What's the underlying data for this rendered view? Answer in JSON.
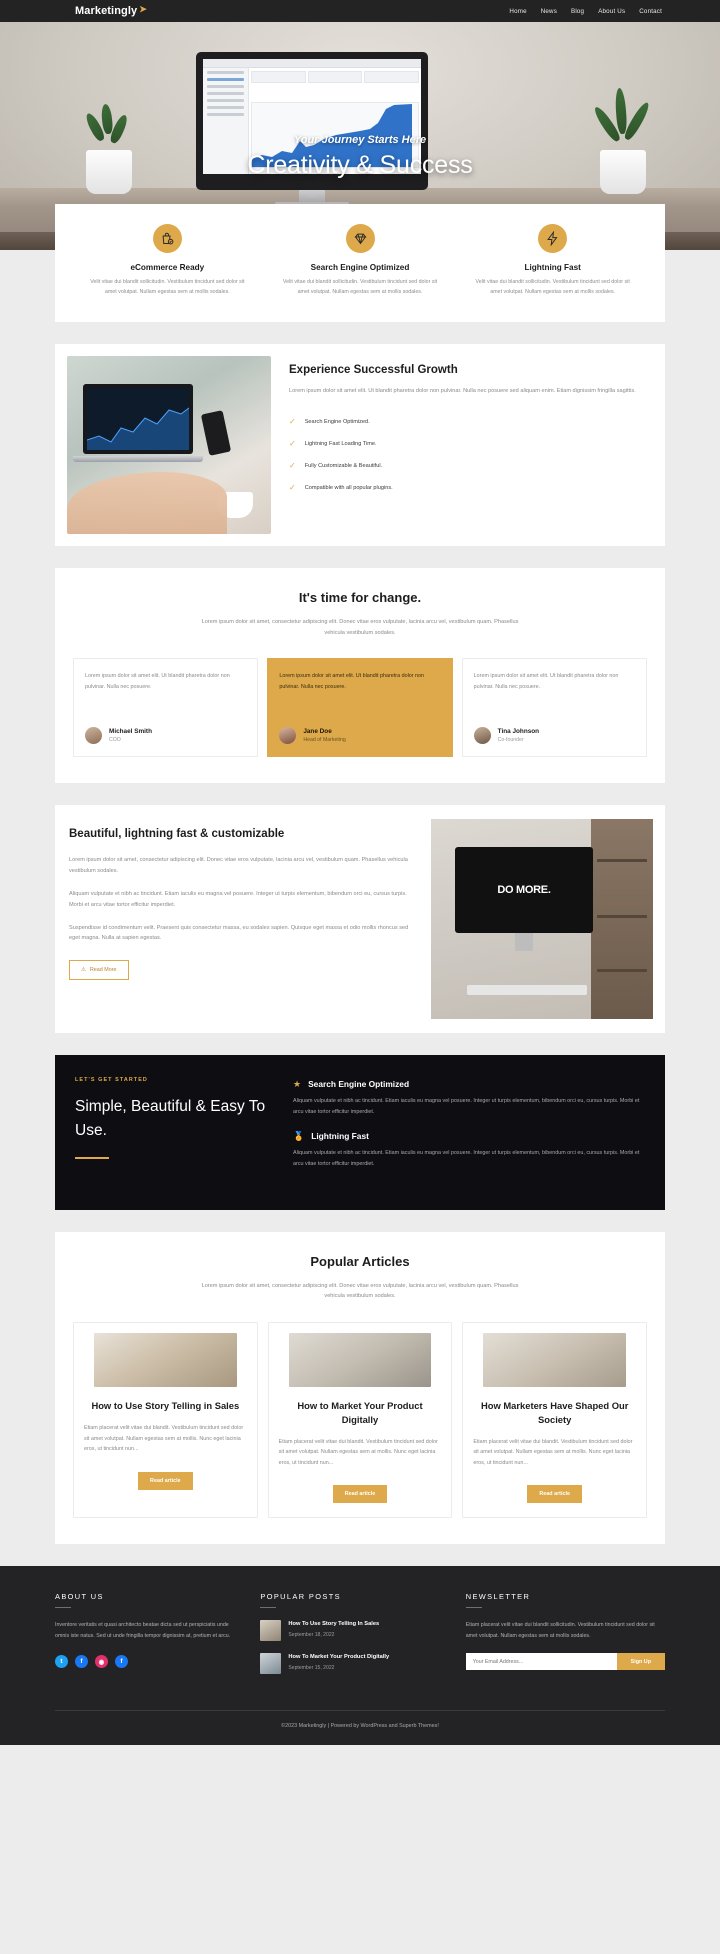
{
  "header": {
    "brand": "Marketingly",
    "brand_icon": "paper-plane-icon",
    "nav": [
      {
        "label": "Home"
      },
      {
        "label": "News"
      },
      {
        "label": "Blog"
      },
      {
        "label": "About Us"
      },
      {
        "label": "Contact"
      }
    ]
  },
  "hero": {
    "subtitle": "Your Journey Starts Here",
    "title": "Creativity & Success"
  },
  "features": [
    {
      "icon": "shopping-bag-check-icon",
      "title": "eCommerce Ready",
      "desc": "Velit vitae dui blandit sollicitudin. Vestibulum tincidunt sed dolor sit amet volutpat. Nullam egestas sem at mollis sodales."
    },
    {
      "icon": "diamond-icon",
      "title": "Search Engine Optimized",
      "desc": "Velit vitae dui blandit sollicitudin. Vestibulum tincidunt sed dolor sit amet volutpat. Nullam egestas sem at mollis sodales."
    },
    {
      "icon": "lightning-bolt-icon",
      "title": "Lightning Fast",
      "desc": "Velit vitae dui blandit sollicitudin. Vestibulum tincidunt sed dolor sit amet volutpat. Nullam egestas sem at mollis sodales."
    }
  ],
  "growth": {
    "title": "Experience Successful Growth",
    "paragraph": "Lorem ipsum dolor sit amet elit. Ut blandit pharetra dolor non pulvinar. Nulla nec posuere sed aliquam enim. Etiam dignissim fringilla sagittis.",
    "checks": [
      "Search Engine Optimized.",
      "Lightning Fast Loading Time.",
      "Fully Customizable & Beautiful.",
      "Compatible with all popular plugins."
    ]
  },
  "testimonials": {
    "title": "It's time for change.",
    "intro": "Lorem ipsum dolor sit amet, consectetur adipiscing elit. Donec vitae eros vulputate, lacinia arcu vel, vestibulum quam. Phasellus vehicula vestibulum sodales.",
    "cards": [
      {
        "quote": "Lorem ipsum dolor sit amet elit. Ut blandit pharetra dolor non pulvinar. Nulla nec posuere.",
        "name": "Michael Smith",
        "role": "COO"
      },
      {
        "quote": "Lorem ipsum dolor sit amet elit. Ut blandit pharetra dolor non pulvinar. Nulla nec posuere.",
        "name": "Jane Doe",
        "role": "Head of Marketing"
      },
      {
        "quote": "Lorem ipsum dolor sit amet elit. Ut blandit pharetra dolor non pulvinar. Nulla nec posuere.",
        "name": "Tina Johnson",
        "role": "Co-founder"
      }
    ]
  },
  "beauty": {
    "title": "Beautiful, lightning fast & customizable",
    "p1": "Lorem ipsum dolor sit amet, consectetur adipiscing elit. Donec vitae eros vulputate, lacinia arcu vel, vestibulum quam. Phasellus vehicula vestibulum sodales.",
    "p2": "Aliquam vulputate et nibh ac tincidunt. Etiam iaculis eu magna vel posuere. Integer ut turpis elementum, bibendum orci eu, cursus turpis. Morbi et arcu vitae tortor efficitur imperdiet.",
    "p3": "Suspendisse id condimentum velit. Praesent quis consectetur massa, eu sodales sapien. Quisque eget massa et odio mollis rhoncus sed eget magna. Nulla at sapien egestas.",
    "button": "Read More",
    "button_icon": "lightbulb-icon",
    "monitor_text": "DO MORE."
  },
  "cta": {
    "kicker": "LET'S GET STARTED",
    "headline": "Simple, Beautiful & Easy To Use.",
    "items": [
      {
        "icon": "star-icon",
        "title": "Search Engine Optimized",
        "desc": "Aliquam vulputate et nibh ac tincidunt. Etiam iaculis eu magna vel posuere. Integer ut turpis elementum, bibendum orci eu, cursus turpis. Morbi et arcu vitae tortor efficitur imperdiet."
      },
      {
        "icon": "medal-icon",
        "title": "Lightning Fast",
        "desc": "Aliquam vulputate et nibh ac tincidunt. Etiam iaculis eu magna vel posuere. Integer ut turpis elementum, bibendum orci eu, cursus turpis. Morbi et arcu vitae tortor efficitur imperdiet."
      }
    ]
  },
  "articles": {
    "title": "Popular Articles",
    "intro": "Lorem ipsum dolor sit amet, consectetur adipiscing elit. Donec vitae eros vulputate, lacinia arcu vel, vestibulum quam. Phasellus vehicula vestibulum sodales.",
    "cards": [
      {
        "heading": "How to Use Story Telling in Sales",
        "excerpt": "Etiam placerat velit vitae dui blandit. Vestibulum tincidunt sed dolor sit amet volutpat. Nullam egestas sem at mollis. Nunc eget lacinia eros, ut tincidunt nun...",
        "button": "Read article"
      },
      {
        "heading": "How to Market Your Product Digitally",
        "excerpt": "Etiam placerat velit vitae dui blandit. Vestibulum tincidunt sed dolor sit amet volutpat. Nullam egestas sem at mollis. Nunc eget lacinia eros, ut tincidunt nun...",
        "button": "Read article"
      },
      {
        "heading": "How Marketers Have Shaped Our Society",
        "excerpt": "Etiam placerat velit vitae dui blandit. Vestibulum tincidunt sed dolor sit amet volutpat. Nullam egestas sem at mollis. Nunc eget lacinia eros, ut tincidunt nun...",
        "button": "Read article"
      }
    ]
  },
  "footer": {
    "about": {
      "title": "ABOUT US",
      "text": "Inventore veritatis et quasi architecto beatae dicta sed ut perspiciatis unde omnis iste natus. Sed ut unde fringilla tempor dignissim at, pretium et arcu.",
      "socials": [
        {
          "name": "twitter-icon",
          "glyph": "t"
        },
        {
          "name": "facebook-icon",
          "glyph": "f"
        },
        {
          "name": "instagram-icon",
          "glyph": "◉"
        },
        {
          "name": "facebook-alt-icon",
          "glyph": "f"
        }
      ]
    },
    "posts": {
      "title": "POPULAR POSTS",
      "items": [
        {
          "title": "How To Use Story Telling In Sales",
          "date": "September 18, 2022"
        },
        {
          "title": "How To Market Your Product Digitally",
          "date": "September 15, 2022"
        }
      ]
    },
    "newsletter": {
      "title": "NEWSLETTER",
      "text": "Etiam placerat velit vitae dui blandit sollicitudin. Vestibulum tincidunt sed dolor sit amet volutpat. Nullam egestas sem at mollis sodales.",
      "placeholder": "Your Email Address...",
      "button": "Sign Up"
    },
    "copyright": "©2023 Marketingly | Powered by WordPress and Superb Themes!"
  },
  "colors": {
    "accent": "#dda94a",
    "dark": "#232325",
    "cta_bg": "#0e0e12"
  }
}
